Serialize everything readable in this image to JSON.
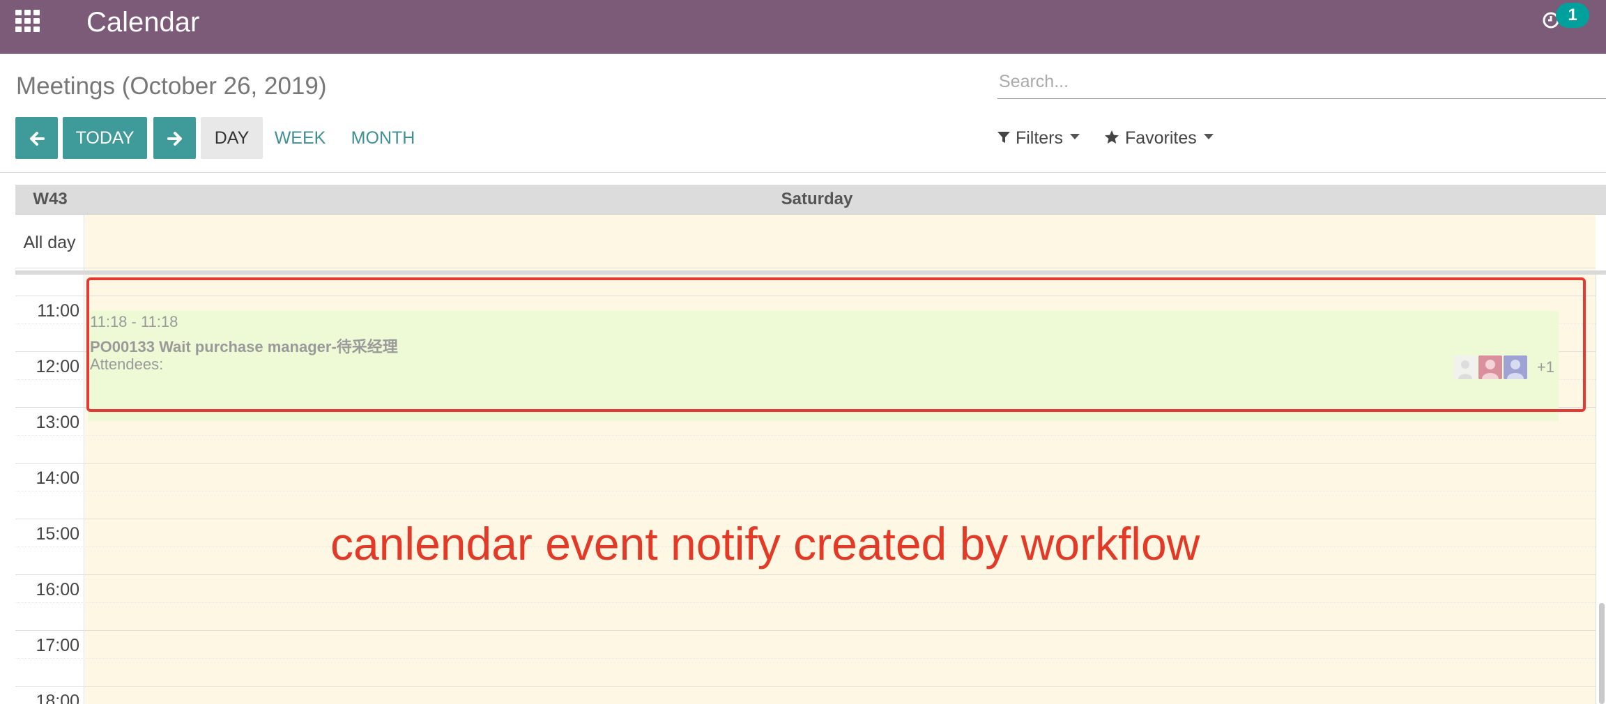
{
  "navbar": {
    "app_title": "Calendar",
    "activity_count": "1",
    "apps_icon": "grid-icon",
    "activity_icon": "clock-icon",
    "color": "#7c5b78"
  },
  "control_panel": {
    "breadcrumb": "Meetings (October 26, 2019)",
    "search_placeholder": "Search...",
    "buttons": {
      "today": "TODAY",
      "day": "DAY",
      "week": "WEEK",
      "month": "MONTH"
    },
    "filters_label": "Filters",
    "favorites_label": "Favorites",
    "accent_color": "#3f9a9a"
  },
  "calendar": {
    "week_label": "W43",
    "day_label": "Saturday",
    "allday_label": "All day",
    "times": [
      "11:00",
      "12:00",
      "13:00",
      "14:00",
      "15:00",
      "16:00",
      "17:00",
      "18:00"
    ]
  },
  "event": {
    "time": "11:18 - 11:18",
    "title": "PO00133 Wait purchase manager-待采经理",
    "attendees_label": "Attendees:",
    "more_attendees": "+1",
    "background_color": "#eefad6"
  },
  "annotation": {
    "text": "canlendar event notify created by workflow",
    "color": "#e23a27"
  }
}
